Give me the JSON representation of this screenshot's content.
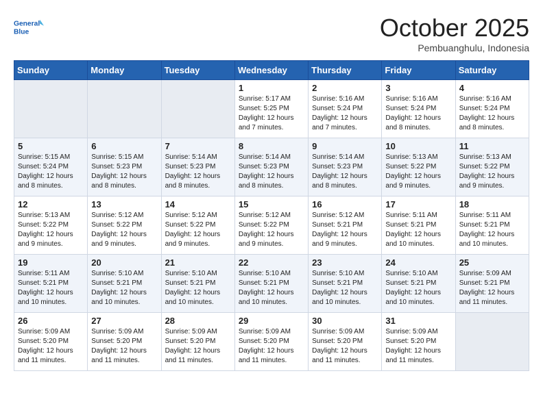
{
  "header": {
    "logo_line1": "General",
    "logo_line2": "Blue",
    "month": "October 2025",
    "location": "Pembuanghulu, Indonesia"
  },
  "weekdays": [
    "Sunday",
    "Monday",
    "Tuesday",
    "Wednesday",
    "Thursday",
    "Friday",
    "Saturday"
  ],
  "weeks": [
    [
      {
        "day": "",
        "info": ""
      },
      {
        "day": "",
        "info": ""
      },
      {
        "day": "",
        "info": ""
      },
      {
        "day": "1",
        "info": "Sunrise: 5:17 AM\nSunset: 5:25 PM\nDaylight: 12 hours\nand 7 minutes."
      },
      {
        "day": "2",
        "info": "Sunrise: 5:16 AM\nSunset: 5:24 PM\nDaylight: 12 hours\nand 7 minutes."
      },
      {
        "day": "3",
        "info": "Sunrise: 5:16 AM\nSunset: 5:24 PM\nDaylight: 12 hours\nand 8 minutes."
      },
      {
        "day": "4",
        "info": "Sunrise: 5:16 AM\nSunset: 5:24 PM\nDaylight: 12 hours\nand 8 minutes."
      }
    ],
    [
      {
        "day": "5",
        "info": "Sunrise: 5:15 AM\nSunset: 5:24 PM\nDaylight: 12 hours\nand 8 minutes."
      },
      {
        "day": "6",
        "info": "Sunrise: 5:15 AM\nSunset: 5:23 PM\nDaylight: 12 hours\nand 8 minutes."
      },
      {
        "day": "7",
        "info": "Sunrise: 5:14 AM\nSunset: 5:23 PM\nDaylight: 12 hours\nand 8 minutes."
      },
      {
        "day": "8",
        "info": "Sunrise: 5:14 AM\nSunset: 5:23 PM\nDaylight: 12 hours\nand 8 minutes."
      },
      {
        "day": "9",
        "info": "Sunrise: 5:14 AM\nSunset: 5:23 PM\nDaylight: 12 hours\nand 8 minutes."
      },
      {
        "day": "10",
        "info": "Sunrise: 5:13 AM\nSunset: 5:22 PM\nDaylight: 12 hours\nand 9 minutes."
      },
      {
        "day": "11",
        "info": "Sunrise: 5:13 AM\nSunset: 5:22 PM\nDaylight: 12 hours\nand 9 minutes."
      }
    ],
    [
      {
        "day": "12",
        "info": "Sunrise: 5:13 AM\nSunset: 5:22 PM\nDaylight: 12 hours\nand 9 minutes."
      },
      {
        "day": "13",
        "info": "Sunrise: 5:12 AM\nSunset: 5:22 PM\nDaylight: 12 hours\nand 9 minutes."
      },
      {
        "day": "14",
        "info": "Sunrise: 5:12 AM\nSunset: 5:22 PM\nDaylight: 12 hours\nand 9 minutes."
      },
      {
        "day": "15",
        "info": "Sunrise: 5:12 AM\nSunset: 5:22 PM\nDaylight: 12 hours\nand 9 minutes."
      },
      {
        "day": "16",
        "info": "Sunrise: 5:12 AM\nSunset: 5:21 PM\nDaylight: 12 hours\nand 9 minutes."
      },
      {
        "day": "17",
        "info": "Sunrise: 5:11 AM\nSunset: 5:21 PM\nDaylight: 12 hours\nand 10 minutes."
      },
      {
        "day": "18",
        "info": "Sunrise: 5:11 AM\nSunset: 5:21 PM\nDaylight: 12 hours\nand 10 minutes."
      }
    ],
    [
      {
        "day": "19",
        "info": "Sunrise: 5:11 AM\nSunset: 5:21 PM\nDaylight: 12 hours\nand 10 minutes."
      },
      {
        "day": "20",
        "info": "Sunrise: 5:10 AM\nSunset: 5:21 PM\nDaylight: 12 hours\nand 10 minutes."
      },
      {
        "day": "21",
        "info": "Sunrise: 5:10 AM\nSunset: 5:21 PM\nDaylight: 12 hours\nand 10 minutes."
      },
      {
        "day": "22",
        "info": "Sunrise: 5:10 AM\nSunset: 5:21 PM\nDaylight: 12 hours\nand 10 minutes."
      },
      {
        "day": "23",
        "info": "Sunrise: 5:10 AM\nSunset: 5:21 PM\nDaylight: 12 hours\nand 10 minutes."
      },
      {
        "day": "24",
        "info": "Sunrise: 5:10 AM\nSunset: 5:21 PM\nDaylight: 12 hours\nand 10 minutes."
      },
      {
        "day": "25",
        "info": "Sunrise: 5:09 AM\nSunset: 5:21 PM\nDaylight: 12 hours\nand 11 minutes."
      }
    ],
    [
      {
        "day": "26",
        "info": "Sunrise: 5:09 AM\nSunset: 5:20 PM\nDaylight: 12 hours\nand 11 minutes."
      },
      {
        "day": "27",
        "info": "Sunrise: 5:09 AM\nSunset: 5:20 PM\nDaylight: 12 hours\nand 11 minutes."
      },
      {
        "day": "28",
        "info": "Sunrise: 5:09 AM\nSunset: 5:20 PM\nDaylight: 12 hours\nand 11 minutes."
      },
      {
        "day": "29",
        "info": "Sunrise: 5:09 AM\nSunset: 5:20 PM\nDaylight: 12 hours\nand 11 minutes."
      },
      {
        "day": "30",
        "info": "Sunrise: 5:09 AM\nSunset: 5:20 PM\nDaylight: 12 hours\nand 11 minutes."
      },
      {
        "day": "31",
        "info": "Sunrise: 5:09 AM\nSunset: 5:20 PM\nDaylight: 12 hours\nand 11 minutes."
      },
      {
        "day": "",
        "info": ""
      }
    ]
  ]
}
